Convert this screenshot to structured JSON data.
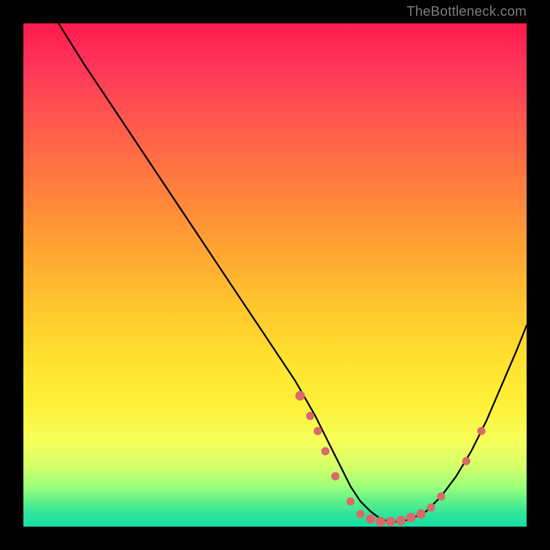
{
  "watermark": "TheBottleneck.com",
  "chart_data": {
    "type": "line",
    "title": "",
    "xlabel": "",
    "ylabel": "",
    "xlim": [
      0,
      100
    ],
    "ylim": [
      0,
      100
    ],
    "grid": false,
    "legend": false,
    "series": [
      {
        "name": "curve",
        "x": [
          7,
          12,
          18,
          24,
          30,
          36,
          42,
          48,
          54,
          58,
          61,
          63,
          65,
          67,
          69,
          71,
          73,
          75,
          77,
          80,
          83,
          86,
          89,
          92,
          95,
          98,
          100
        ],
        "y": [
          100,
          92,
          83,
          74,
          65,
          56,
          47,
          38,
          29,
          22,
          16,
          12,
          8,
          5,
          3,
          1.5,
          1,
          1,
          1.5,
          3,
          6,
          10,
          15,
          21,
          28,
          35,
          40
        ]
      }
    ],
    "points": {
      "name": "highlight-dots",
      "coords": [
        {
          "x": 55,
          "y": 26,
          "r": 7
        },
        {
          "x": 57,
          "y": 22,
          "r": 6
        },
        {
          "x": 58.5,
          "y": 19,
          "r": 6
        },
        {
          "x": 60,
          "y": 15,
          "r": 6
        },
        {
          "x": 62,
          "y": 10,
          "r": 6
        },
        {
          "x": 65,
          "y": 5,
          "r": 6
        },
        {
          "x": 67,
          "y": 2.5,
          "r": 6
        },
        {
          "x": 69,
          "y": 1.5,
          "r": 7
        },
        {
          "x": 71,
          "y": 1,
          "r": 7
        },
        {
          "x": 73,
          "y": 1,
          "r": 7
        },
        {
          "x": 75,
          "y": 1.2,
          "r": 7
        },
        {
          "x": 77,
          "y": 1.8,
          "r": 7
        },
        {
          "x": 79,
          "y": 2.5,
          "r": 7
        },
        {
          "x": 81,
          "y": 3.8,
          "r": 6
        },
        {
          "x": 83,
          "y": 6,
          "r": 6
        },
        {
          "x": 88,
          "y": 13,
          "r": 6
        },
        {
          "x": 91,
          "y": 19,
          "r": 6
        }
      ]
    },
    "gradient_bands": [
      {
        "pos": 0,
        "color": "#ff1a4d"
      },
      {
        "pos": 0.45,
        "color": "#ffa233"
      },
      {
        "pos": 0.75,
        "color": "#fff13a"
      },
      {
        "pos": 1.0,
        "color": "#14dfa6"
      }
    ]
  }
}
